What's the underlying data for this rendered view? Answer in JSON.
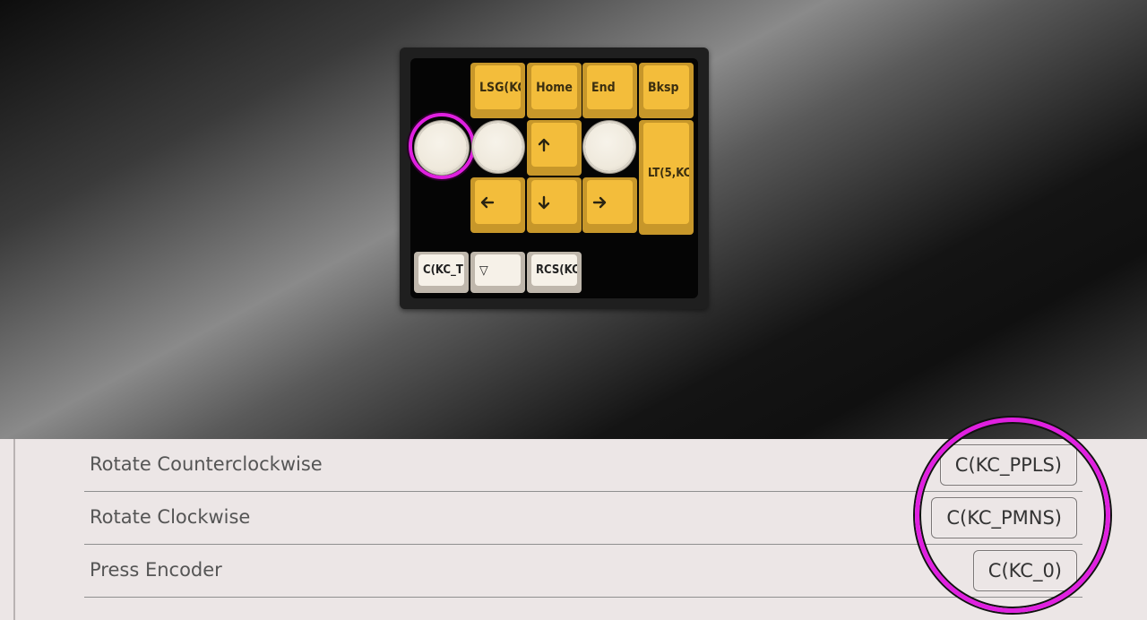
{
  "keyboard": {
    "keys": {
      "lsg": "LSG(KC",
      "home": "Home",
      "end": "End",
      "bksp": "Bksp",
      "lt5": "LT(5,KC",
      "ckc_t": "C(KC_T",
      "triangle": "▽",
      "rcs": "RCS(KC"
    },
    "arrows": {
      "up": "arrow-up-icon",
      "down": "arrow-down-icon",
      "left": "arrow-left-icon",
      "right": "arrow-right-icon"
    },
    "colors": {
      "key_yellow": "#f3bd3b",
      "key_yellow_base": "#c7972a",
      "key_white": "#f6f1e8",
      "highlight_ring": "#e020e0"
    }
  },
  "encoder_panel": {
    "rows": [
      {
        "label": "Rotate Counterclockwise",
        "value": "C(KC_PPLS)"
      },
      {
        "label": "Rotate Clockwise",
        "value": "C(KC_PMNS)"
      },
      {
        "label": "Press Encoder",
        "value": "C(KC_0)"
      }
    ]
  }
}
